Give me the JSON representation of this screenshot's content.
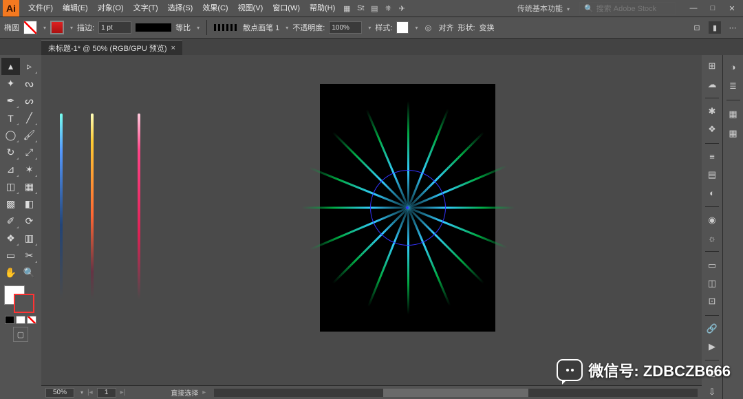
{
  "app": {
    "logo": "Ai"
  },
  "menus": {
    "file": "文件(F)",
    "edit": "编辑(E)",
    "object": "对象(O)",
    "type": "文字(T)",
    "select": "选择(S)",
    "effect": "效果(C)",
    "view": "视图(V)",
    "window": "窗口(W)",
    "help": "帮助(H)"
  },
  "workspace": {
    "label": "传统基本功能"
  },
  "search": {
    "placeholder": "搜索 Adobe Stock",
    "icon_label": "🔍"
  },
  "window_controls": {
    "min": "—",
    "max": "□",
    "close": "✕"
  },
  "controlbar": {
    "tool_name": "椭圆",
    "stroke_label": "描边:",
    "stroke_value": "1 pt",
    "ratio_label": "等比",
    "brush_label": "散点画笔 1",
    "opacity_label": "不透明度:",
    "opacity_value": "100%",
    "style_label": "样式:",
    "align_label": "对齐",
    "shape_label": "形状:",
    "transform_label": "变换"
  },
  "document": {
    "tab_title": "未标题-1* @ 50% (RGB/GPU 预览)",
    "close": "×"
  },
  "status": {
    "zoom": "50%",
    "artboard_nav": "1",
    "mode": "直接选择"
  },
  "watermark": {
    "prefix": "微信号:",
    "id": "ZDBCZB666"
  },
  "tool_icons": {
    "selection": "▴",
    "direct": "▹",
    "wand": "✦",
    "lasso": "ᔓ",
    "pen": "✒",
    "curvature": "ᔕ",
    "type": "T",
    "line": "╱",
    "ellipse": "◯",
    "brush": "🖌",
    "rotate": "↻",
    "scale": "⤢",
    "width": "⊿",
    "freeform": "✶",
    "shapebuilder": "◫",
    "perspective": "▦",
    "mesh": "▩",
    "gradient": "◧",
    "eyedropper": "✐",
    "blend": "⟳",
    "symbol": "❖",
    "graph": "▥",
    "artboard": "▭",
    "slice": "✂",
    "hand": "✋",
    "zoom": "🔍"
  },
  "dock_icons": {
    "properties": "⊞",
    "layers": "≣",
    "libraries": "☁",
    "color": "◑",
    "swatches": "▦",
    "brushes": "✱",
    "symbols": "❖",
    "stroke": "≡",
    "gradient": "▤",
    "transparency": "◐",
    "appearance": "◉",
    "graphic_styles": "☼",
    "align": "▭",
    "pathfinder": "◫",
    "transform": "⊡",
    "links": "🔗",
    "actions": "▶",
    "artboards": "◻",
    "asset_export": "⇩"
  }
}
